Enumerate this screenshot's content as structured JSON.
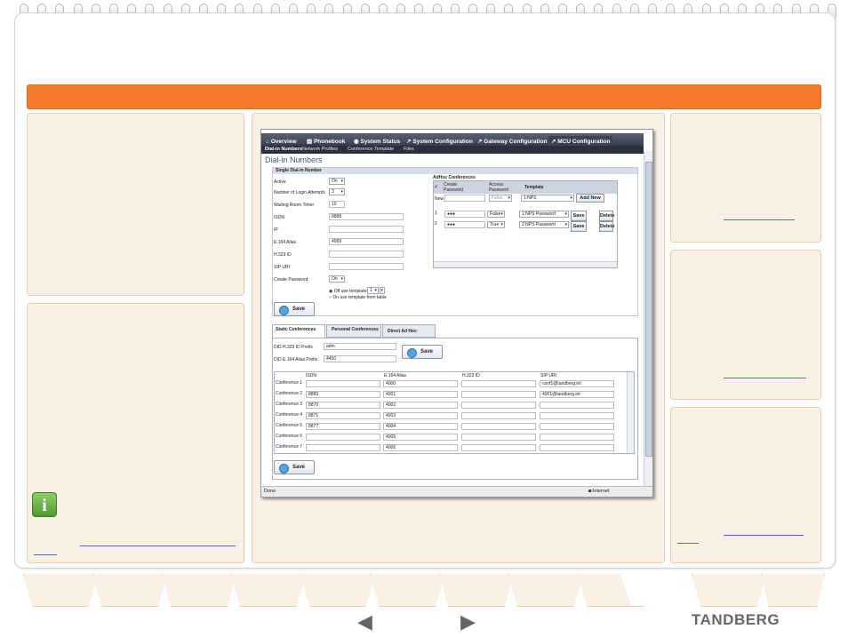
{
  "app": {
    "title": "MCU Configuration",
    "brand": "TANDBERG",
    "accent_color": "#f47a2b"
  },
  "main_tabs": [
    {
      "label": "Overview"
    },
    {
      "label": "Phonebook"
    },
    {
      "label": "System Status"
    },
    {
      "label": "System Configuration"
    },
    {
      "label": "Gateway Configuration"
    },
    {
      "label": "MCU Configuration"
    }
  ],
  "sub_tabs": [
    {
      "label": "Dial-in Numbers"
    },
    {
      "label": "Network Profiles"
    },
    {
      "label": "Conference Template"
    },
    {
      "label": "Files"
    }
  ],
  "page_title": "Dial-in Numbers",
  "single": {
    "heading": "Single Dial-in Number",
    "active_label": "Active",
    "active_value": "On",
    "login_attempts_label": "Number of Login Attempts",
    "login_attempts_value": "3",
    "waiting_timer_label": "Waiting Room Timer",
    "waiting_timer_value": "10",
    "isdn_label": "ISDN",
    "isdn_value": "8888",
    "ip_label": "IP",
    "e164_label": "E.164 Alias",
    "e164_value": "4999",
    "h323_label": "H.323 ID",
    "sip_label": "SIP URI",
    "create_pwd_label": "Create Password",
    "create_pwd_value": "On",
    "radio_off_label": "Off use template:",
    "radio_off_value": "1",
    "radio_on_label": "On use template from table",
    "save_label": "Save"
  },
  "adhoc": {
    "heading": "AdHoc Conferences",
    "col_hash": "#",
    "col_create": "Create Password",
    "col_access": "Access Password",
    "col_template": "Template",
    "new_label": "New",
    "new_access": "False",
    "new_template": "1:NPS",
    "add_new_label": "Add New",
    "rows": [
      {
        "num": "1",
        "pwd": "●●●",
        "access": "False",
        "template": "1:NPS Password",
        "save": "Save",
        "delete": "Delete"
      },
      {
        "num": "2",
        "pwd": "●●●",
        "access": "True",
        "template": "2:NPS Password",
        "save": "Save",
        "delete": "Delete"
      }
    ]
  },
  "conf_tabs": [
    {
      "label": "Static Conferences"
    },
    {
      "label": "Personal Conferences"
    },
    {
      "label": "Direct Ad Hoc"
    }
  ],
  "prefix": {
    "h323_label": "DID H.323 ID Prefix",
    "h323_value": "adm",
    "e164_label": "DID E.164 Alias Prefix",
    "e164_value": "4450",
    "save_label": "Save"
  },
  "conf_table": {
    "headers": [
      "ISDN",
      "E.164 Alias",
      "H.323 ID",
      "SIP URI"
    ],
    "rows": [
      {
        "name": "Conference 1",
        "isdn": "",
        "e164": "4000",
        "h323": "",
        "sip": "conf1@tandberg.int"
      },
      {
        "name": "Conference 2",
        "isdn": "8889",
        "e164": "4001",
        "h323": "",
        "sip": "4001@tandberg.int"
      },
      {
        "name": "Conference 3",
        "isdn": "8870",
        "e164": "4002",
        "h323": "",
        "sip": ""
      },
      {
        "name": "Conference 4",
        "isdn": "8871",
        "e164": "4003",
        "h323": "",
        "sip": ""
      },
      {
        "name": "Conference 5",
        "isdn": "8877",
        "e164": "4004",
        "h323": "",
        "sip": ""
      },
      {
        "name": "Conference 6",
        "isdn": "",
        "e164": "4005",
        "h323": "",
        "sip": ""
      },
      {
        "name": "Conference 7",
        "isdn": "",
        "e164": "4006",
        "h323": "",
        "sip": ""
      }
    ],
    "save_label": "Save"
  },
  "status_bar": {
    "left": "Done",
    "zone": "Internet"
  }
}
